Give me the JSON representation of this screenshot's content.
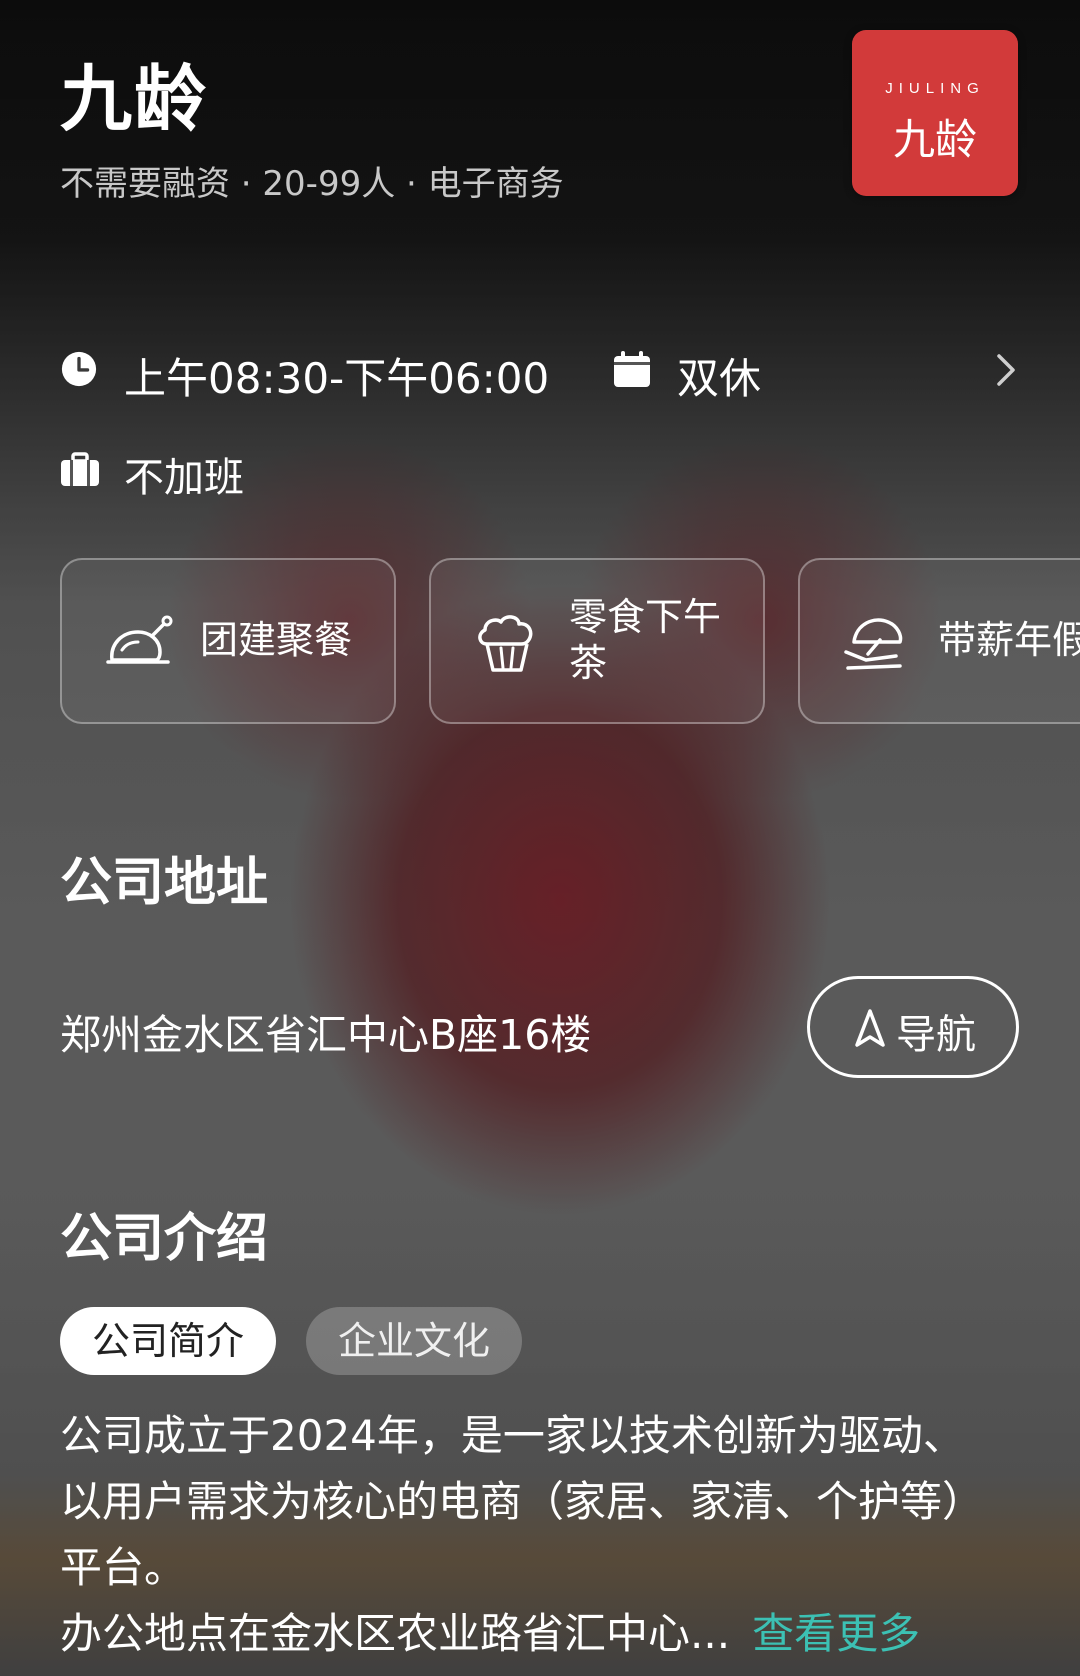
{
  "company": {
    "name": "九龄",
    "meta": "不需要融资 · 20-99人 · 电子商务",
    "logo": {
      "latin": "JIULING",
      "cn": "九龄",
      "color": "#d23a3a"
    }
  },
  "schedule": {
    "hours": "上午08:30-下午06:00",
    "rest": "双休",
    "overtime": "不加班",
    "icons": {
      "clock": "clock-icon",
      "calendar": "calendar-icon",
      "briefcase": "briefcase-icon",
      "more": "chevron-right-icon"
    }
  },
  "benefits": [
    {
      "label": "团建聚餐",
      "icon": "roast-chicken-icon"
    },
    {
      "label": "零食下午\n茶",
      "icon": "cupcake-icon"
    },
    {
      "label": "带薪年假",
      "icon": "sun-lounger-icon"
    }
  ],
  "address": {
    "title": "公司地址",
    "text": "郑州金水区省汇中心B座16楼",
    "nav_label": "导航",
    "nav_icon": "navigation-arrow-icon"
  },
  "intro": {
    "title": "公司介绍",
    "tabs": [
      {
        "label": "公司简介",
        "active": true
      },
      {
        "label": "企业文化",
        "active": false
      }
    ],
    "lines": [
      "公司成立于2024年，是一家以技术创新为驱动、",
      "以用户需求为核心的电商（家居、家清、个护等）",
      "平台。",
      "办公地点在金水区农业路省汇中心..."
    ],
    "more_label": "查看更多",
    "more_color": "#3cc1b4"
  }
}
